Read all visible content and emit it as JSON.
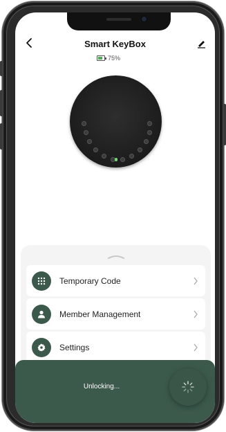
{
  "header": {
    "title": "Smart KeyBox",
    "battery_percent": 75,
    "battery_text": "75%",
    "back_icon": "chevron-left-icon",
    "edit_icon": "pencil-icon"
  },
  "menu": {
    "items": [
      {
        "label": "Temporary Code",
        "icon": "keypad-icon"
      },
      {
        "label": "Member Management",
        "icon": "person-icon"
      },
      {
        "label": "Settings",
        "icon": "gear-icon"
      }
    ]
  },
  "toast": {
    "text": "Unlocking...",
    "icon": "spinner-icon"
  },
  "colors": {
    "accent": "#3c5a4c",
    "battery": "#4caf50",
    "led": "#6fdc6f"
  }
}
